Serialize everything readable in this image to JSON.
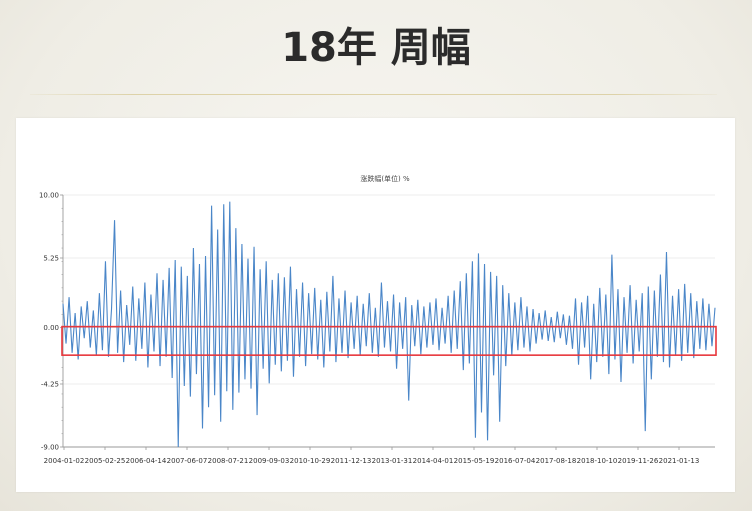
{
  "slide": {
    "title": "18年 周幅"
  },
  "chart_data": {
    "type": "line",
    "title": "涨跌幅(单位) %",
    "x_ticks": [
      "2004-01-02",
      "2005-02-25",
      "2006-04-14",
      "2007-06-07",
      "2008-07-21",
      "2009-09-03",
      "2010-10-29",
      "2011-12-13",
      "2013-01-31",
      "2014-04-01",
      "2015-05-19",
      "2016-07-04",
      "2017-08-18",
      "2018-10-10",
      "2019-11-26",
      "2021-01-13"
    ],
    "y_ticks": [
      "10.00",
      "5.25",
      "0.00",
      "-4.25",
      "-9.00"
    ],
    "ylim": [
      -9,
      10
    ],
    "grid": true,
    "legend": "none",
    "colors": {
      "series": "#4a86c8",
      "highlight": "#e8373c",
      "grid": "#e8e8e8",
      "axis": "#9a9a9a"
    },
    "highlight_band": [
      -2,
      0
    ],
    "values": [
      1.8,
      -1.2,
      2.3,
      -1.9,
      1.1,
      -2.4,
      1.6,
      -0.8,
      2.0,
      -1.5,
      1.3,
      -2.1,
      2.6,
      -1.7,
      5.0,
      -2.2,
      1.4,
      8.1,
      -1.9,
      2.8,
      -2.6,
      1.7,
      -1.3,
      3.1,
      -2.5,
      2.2,
      -1.6,
      3.4,
      -3.0,
      2.5,
      -1.8,
      4.1,
      -2.9,
      3.6,
      -2.2,
      4.5,
      -3.8,
      5.1,
      -9.0,
      4.6,
      -4.4,
      3.9,
      -5.2,
      6.0,
      -3.5,
      4.8,
      -7.6,
      5.4,
      -6.0,
      9.2,
      -5.1,
      7.4,
      -7.1,
      9.3,
      -4.8,
      9.5,
      -6.2,
      7.5,
      -4.9,
      6.3,
      -3.9,
      5.2,
      -4.6,
      6.1,
      -6.6,
      4.4,
      -3.1,
      5.0,
      -4.2,
      3.6,
      -2.8,
      4.1,
      -3.3,
      3.8,
      -2.5,
      4.6,
      -3.7,
      2.9,
      -2.2,
      3.4,
      -2.9,
      2.6,
      -2.0,
      3.0,
      -2.4,
      2.1,
      -3.0,
      2.7,
      -1.8,
      3.9,
      -2.6,
      2.2,
      -1.9,
      2.8,
      -2.3,
      1.9,
      -1.6,
      2.4,
      -2.1,
      1.8,
      -1.4,
      2.6,
      -1.9,
      1.5,
      -2.2,
      3.4,
      -1.5,
      2.0,
      -1.8,
      2.5,
      -3.1,
      1.9,
      -1.6,
      2.3,
      -5.5,
      1.7,
      -1.4,
      2.1,
      -2.0,
      1.6,
      -1.5,
      1.9,
      -1.3,
      2.2,
      -1.7,
      1.5,
      -1.2,
      2.4,
      -1.9,
      2.8,
      -1.6,
      3.5,
      -3.2,
      4.1,
      -2.7,
      5.0,
      -8.3,
      5.6,
      -6.4,
      4.8,
      -8.5,
      4.2,
      -3.6,
      3.9,
      -7.1,
      3.2,
      -2.9,
      2.6,
      -2.1,
      1.9,
      -1.7,
      2.3,
      -1.5,
      1.6,
      -1.8,
      1.4,
      -1.2,
      1.1,
      -0.9,
      1.3,
      -1.0,
      0.8,
      -1.1,
      1.2,
      -0.8,
      1.0,
      -1.3,
      0.9,
      -1.6,
      2.2,
      -2.8,
      1.9,
      -1.5,
      2.4,
      -3.9,
      1.8,
      -2.6,
      3.0,
      -2.2,
      2.5,
      -3.5,
      5.5,
      -2.4,
      2.9,
      -4.1,
      2.3,
      -1.9,
      3.2,
      -2.7,
      2.1,
      -1.8,
      2.6,
      -7.8,
      3.1,
      -3.9,
      2.8,
      -2.2,
      4.0,
      -2.6,
      5.7,
      -3.0,
      2.4,
      -2.1,
      2.9,
      -2.5,
      3.3,
      -1.9,
      2.6,
      -2.3,
      2.0,
      -1.6,
      2.2,
      -1.7,
      1.8,
      -1.4,
      1.5
    ]
  }
}
